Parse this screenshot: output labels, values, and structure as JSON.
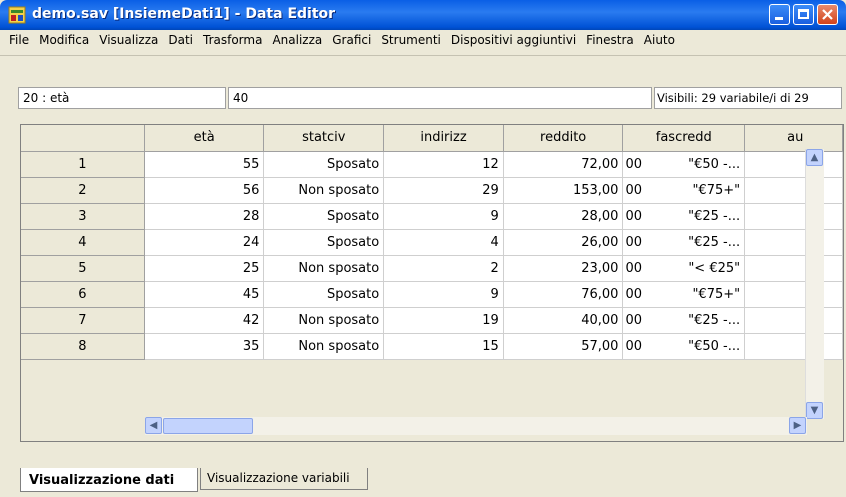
{
  "window": {
    "title": "demo.sav [InsiemeDati1] - Data Editor"
  },
  "menu": [
    "File",
    "Modifica",
    "Visualizza",
    "Dati",
    "Trasforma",
    "Analizza",
    "Grafici",
    "Strumenti",
    "Dispositivi aggiuntivi",
    "Finestra",
    "Aiuto"
  ],
  "cell_editor": {
    "ref": "20 : età",
    "value": "40",
    "visible_info": "Visibili: 29 variabile/i di 29"
  },
  "grid": {
    "columns": [
      "età",
      "statciv",
      "indirizz",
      "reddito",
      "fascredd",
      "au"
    ],
    "rows": [
      {
        "n": "1",
        "eta": "55",
        "statciv": "Sposato",
        "indirizz": "12",
        "reddito": "72,00",
        "fascredd_code": "00",
        "fascredd": "\"€50 -..."
      },
      {
        "n": "2",
        "eta": "56",
        "statciv": "Non sposato",
        "indirizz": "29",
        "reddito": "153,00",
        "fascredd_code": "00",
        "fascredd": "\"€75+\""
      },
      {
        "n": "3",
        "eta": "28",
        "statciv": "Sposato",
        "indirizz": "9",
        "reddito": "28,00",
        "fascredd_code": "00",
        "fascredd": "\"€25 -..."
      },
      {
        "n": "4",
        "eta": "24",
        "statciv": "Sposato",
        "indirizz": "4",
        "reddito": "26,00",
        "fascredd_code": "00",
        "fascredd": "\"€25 -..."
      },
      {
        "n": "5",
        "eta": "25",
        "statciv": "Non sposato",
        "indirizz": "2",
        "reddito": "23,00",
        "fascredd_code": "00",
        "fascredd": "\"< €25\""
      },
      {
        "n": "6",
        "eta": "45",
        "statciv": "Sposato",
        "indirizz": "9",
        "reddito": "76,00",
        "fascredd_code": "00",
        "fascredd": "\"€75+\""
      },
      {
        "n": "7",
        "eta": "42",
        "statciv": "Non sposato",
        "indirizz": "19",
        "reddito": "40,00",
        "fascredd_code": "00",
        "fascredd": "\"€25 -..."
      },
      {
        "n": "8",
        "eta": "35",
        "statciv": "Non sposato",
        "indirizz": "15",
        "reddito": "57,00",
        "fascredd_code": "00",
        "fascredd": "\"€50 -..."
      }
    ]
  },
  "tabs": {
    "data_view": "Visualizzazione dati",
    "variable_view": "Visualizzazione variabili"
  }
}
